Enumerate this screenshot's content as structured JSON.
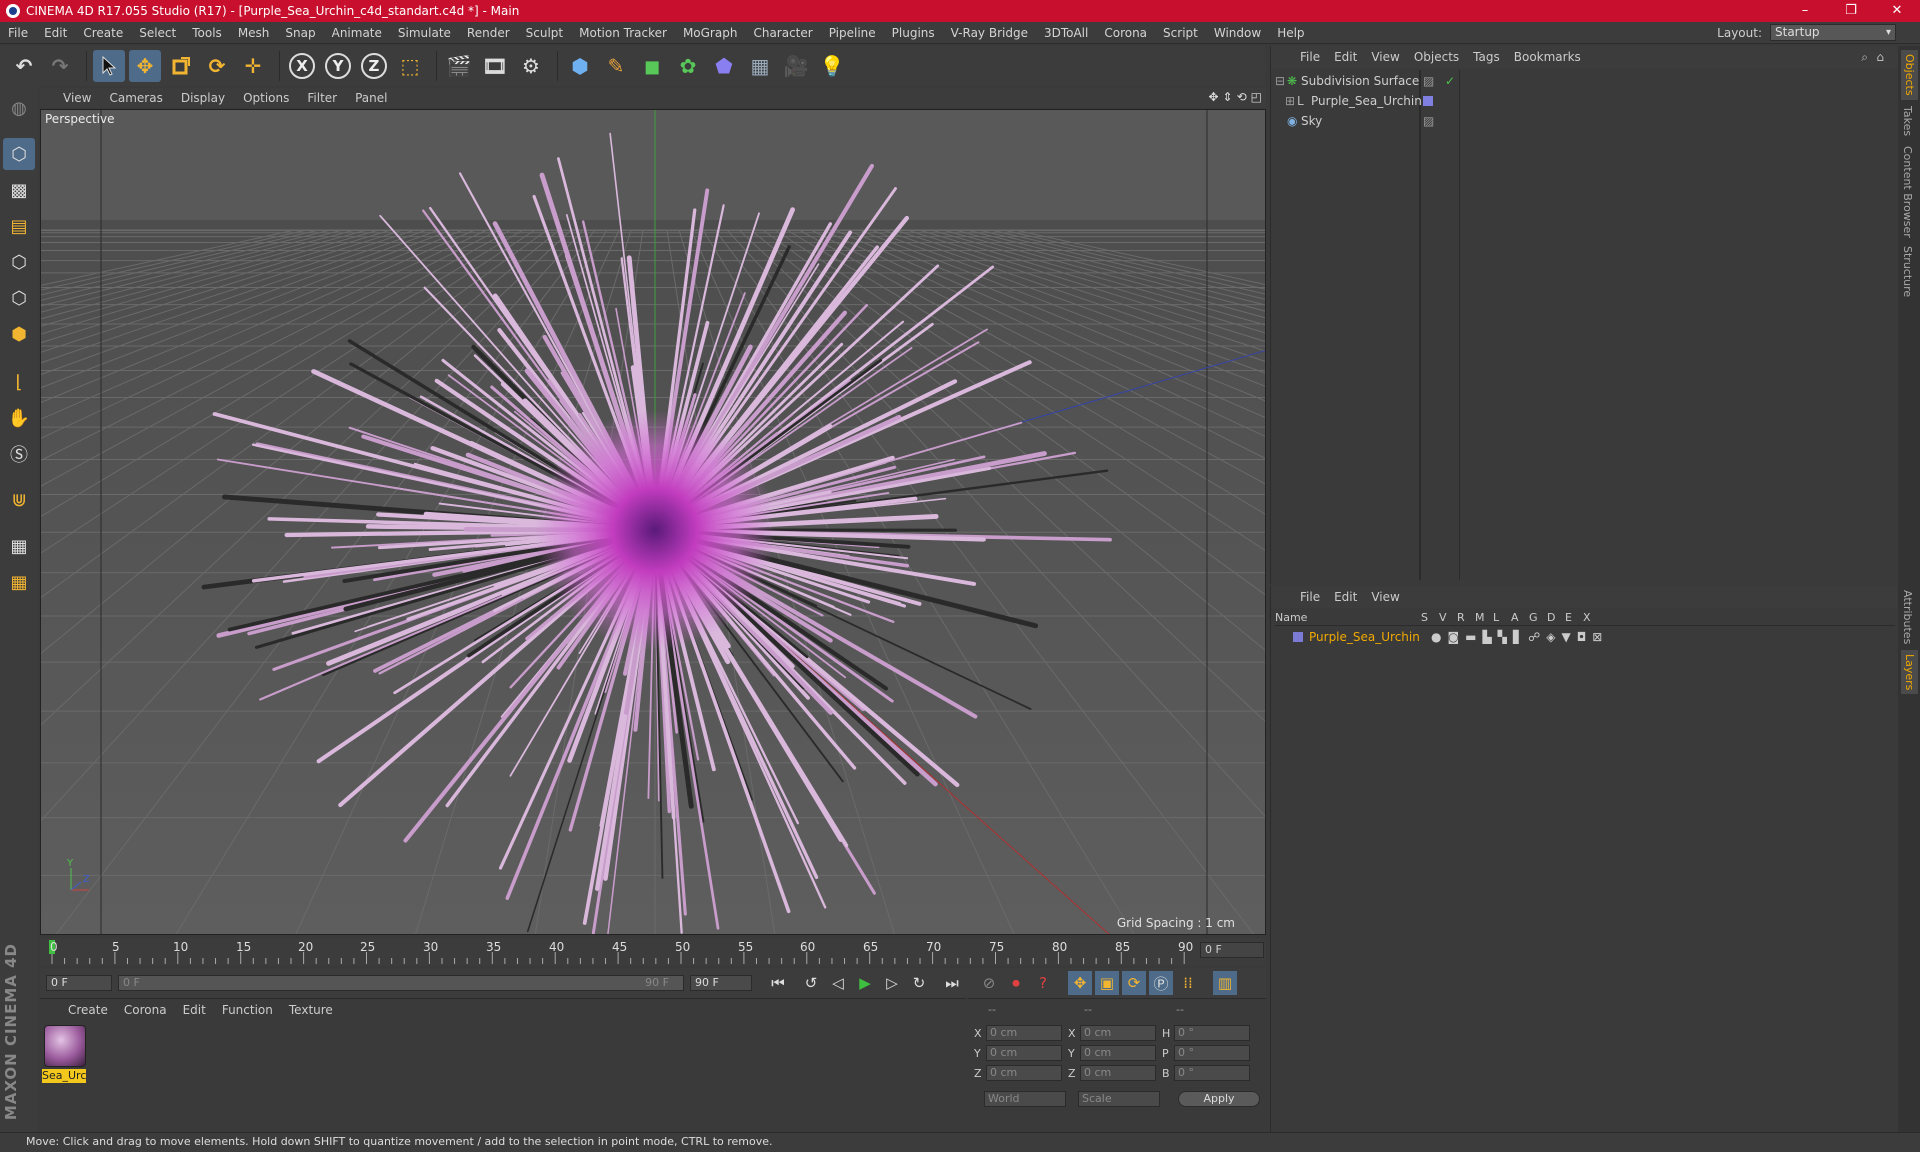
{
  "window": {
    "title": "CINEMA 4D R17.055 Studio (R17) - [Purple_Sea_Urchin_c4d_standart.c4d *] - Main",
    "controls": [
      "–",
      "❐",
      "✕"
    ]
  },
  "menubar": {
    "items": [
      "File",
      "Edit",
      "Create",
      "Select",
      "Tools",
      "Mesh",
      "Snap",
      "Animate",
      "Simulate",
      "Render",
      "Sculpt",
      "Motion Tracker",
      "MoGraph",
      "Character",
      "Pipeline",
      "Plugins",
      "V-Ray Bridge",
      "3DToAll",
      "Corona",
      "Script",
      "Window",
      "Help"
    ],
    "layout_label": "Layout:",
    "layout_value": "Startup"
  },
  "toolbar": {
    "axes": [
      "X",
      "Y",
      "Z"
    ]
  },
  "viewport": {
    "menu": [
      "View",
      "Cameras",
      "Display",
      "Options",
      "Filter",
      "Panel"
    ],
    "label": "Perspective",
    "grid_spacing": "Grid Spacing : 1 cm"
  },
  "timeline": {
    "ticks": [
      "0",
      "5",
      "10",
      "15",
      "20",
      "25",
      "30",
      "35",
      "40",
      "45",
      "50",
      "55",
      "60",
      "65",
      "70",
      "75",
      "80",
      "85",
      "90"
    ],
    "current_frame": "0 F"
  },
  "transport": {
    "start": "0 F",
    "range_start": "0 F",
    "range_end": "90 F",
    "end": "90 F"
  },
  "material_manager": {
    "menu": [
      "Create",
      "Corona",
      "Edit",
      "Function",
      "Texture"
    ],
    "material_name": "Sea_Urc"
  },
  "coordinates": {
    "headers": [
      "--",
      "--",
      "--"
    ],
    "rows": [
      {
        "l1": "X",
        "v1": "0 cm",
        "l2": "X",
        "v2": "0 cm",
        "l3": "H",
        "v3": "0 °"
      },
      {
        "l1": "Y",
        "v1": "0 cm",
        "l2": "Y",
        "v2": "0 cm",
        "l3": "P",
        "v3": "0 °"
      },
      {
        "l1": "Z",
        "v1": "0 cm",
        "l2": "Z",
        "v2": "0 cm",
        "l3": "B",
        "v3": "0 °"
      }
    ],
    "mode": "World",
    "scale": "Scale",
    "apply": "Apply"
  },
  "object_manager": {
    "menu": [
      "File",
      "Edit",
      "View",
      "Objects",
      "Tags",
      "Bookmarks"
    ],
    "objects": [
      {
        "name": "Subdivision Surface",
        "color": "#4fc34f"
      },
      {
        "name": "Purple_Sea_Urchin",
        "color": "#a0a0ff"
      },
      {
        "name": "Sky",
        "color": "#7fb0e0"
      }
    ]
  },
  "layer_manager": {
    "menu": [
      "File",
      "Edit",
      "View"
    ],
    "columns": [
      "Name",
      "S",
      "V",
      "R",
      "M",
      "L",
      "A",
      "G",
      "D",
      "E",
      "X"
    ],
    "layer_name": "Purple_Sea_Urchin",
    "layer_color": "#7b7bd6"
  },
  "side_tabs": [
    "Objects",
    "Takes",
    "Content Browser",
    "Structure",
    "Attributes",
    "Layers"
  ],
  "statusbar": "Move: Click and drag to move elements. Hold down SHIFT to quantize movement / add to the selection in point mode, CTRL to remove.",
  "brand": "MAXON CINEMA 4D"
}
